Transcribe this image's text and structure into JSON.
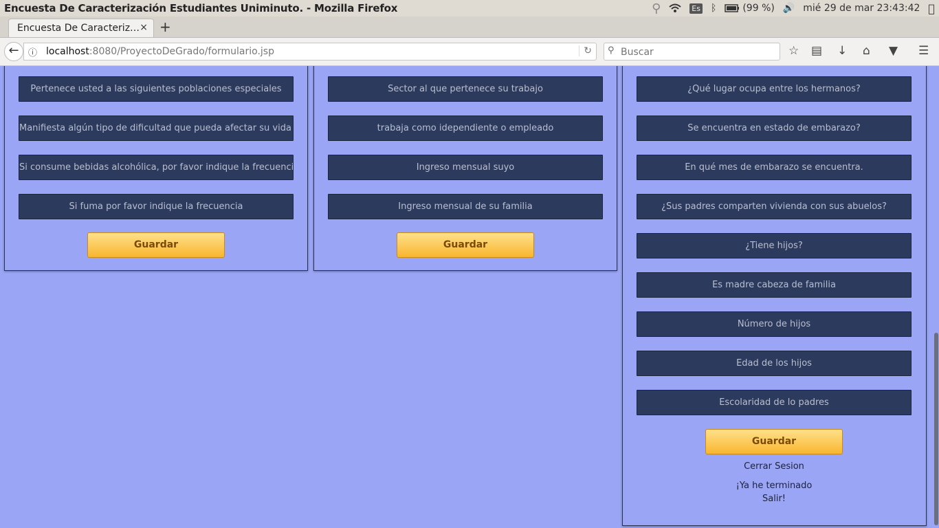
{
  "system_bar": {
    "window_title": "Encuesta De Caracterización Estudiantes Uniminuto. - Mozilla Firefox",
    "keyboard_layout": "Es",
    "battery": "(99 %)",
    "datetime": "mié 29 de mar 23:43:42"
  },
  "browser": {
    "tab_title": "Encuesta De Caracteriz…",
    "tab_close": "×",
    "new_tab": "+",
    "url_host": "localhost",
    "url_path": ":8080/ProyectoDeGrado/formulario.jsp",
    "search_placeholder": "Buscar"
  },
  "panel_left": {
    "fields": [
      "Pertenece usted a las siguientes poblaciones especiales",
      "Manifiesta algún tipo de dificultad que pueda afectar su vida aca",
      "Si consume bebidas alcohólica, por favor indique la frecuencia",
      "Si fuma por favor indique la frecuencia"
    ],
    "save_label": "Guardar"
  },
  "panel_middle": {
    "fields": [
      "Sector al que pertenece su trabajo",
      "trabaja como idependiente o empleado",
      "Ingreso mensual suyo",
      "Ingreso mensual de su familia"
    ],
    "save_label": "Guardar"
  },
  "panel_right": {
    "fields": [
      "¿Qué lugar ocupa entre los hermanos?",
      "Se encuentra en estado de embarazo?",
      "En qué mes de embarazo se encuentra.",
      "¿Sus padres comparten vivienda con sus abuelos?",
      "¿Tiene hijos?",
      "Es madre cabeza de familia",
      "Número de hijos",
      "Edad de los hijos",
      "Escolaridad de lo padres"
    ],
    "save_label": "Guardar",
    "logout_label": "Cerrar Sesion",
    "finish_line1": "¡Ya he terminado",
    "finish_line2": "Salir!"
  }
}
